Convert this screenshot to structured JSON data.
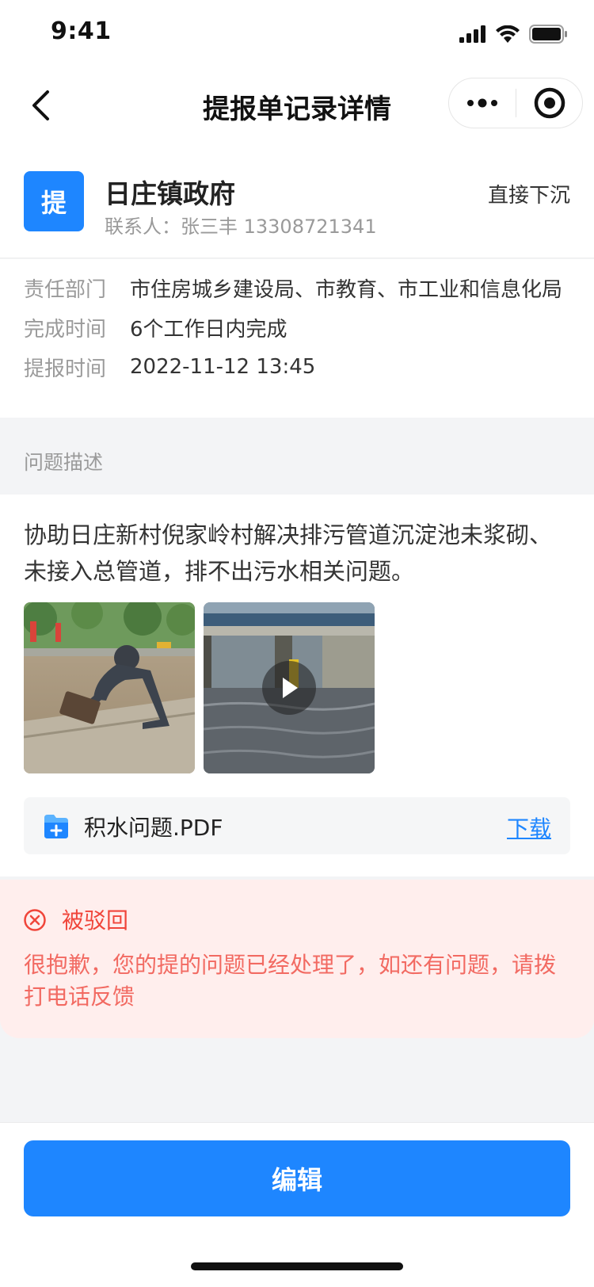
{
  "status_bar": {
    "time": "9:41"
  },
  "nav": {
    "title": "提报单记录详情"
  },
  "report": {
    "badge": "提",
    "org": "日庄镇政府",
    "contact": "联系人：张三丰 13308721341",
    "disposal_type": "直接下沉"
  },
  "info": [
    {
      "label": "责任部门",
      "value": "市住房城乡建设局、市教育、市工业和信息化局"
    },
    {
      "label": "完成时间",
      "value": "6个工作日内完成"
    },
    {
      "label": "提报时间",
      "value": "2022-11-12 13:45"
    }
  ],
  "description": {
    "section_title": "问题描述",
    "text": "协助日庄新村倪家岭村解决排污管道沉淀池未浆砌、未接入总管道，排不出污水相关问题。",
    "attachment": {
      "file_name": "积水问题.PDF",
      "download_label": "下载"
    }
  },
  "rejection": {
    "status": "被驳回",
    "message": "很抱歉，您的提的问题已经处理了，如还有问题，请拨打电话反馈"
  },
  "footer": {
    "edit_label": "编辑"
  },
  "colors": {
    "primary": "#1E86FF",
    "reject": "#F0453A",
    "reject_bg": "#FFEEED"
  }
}
